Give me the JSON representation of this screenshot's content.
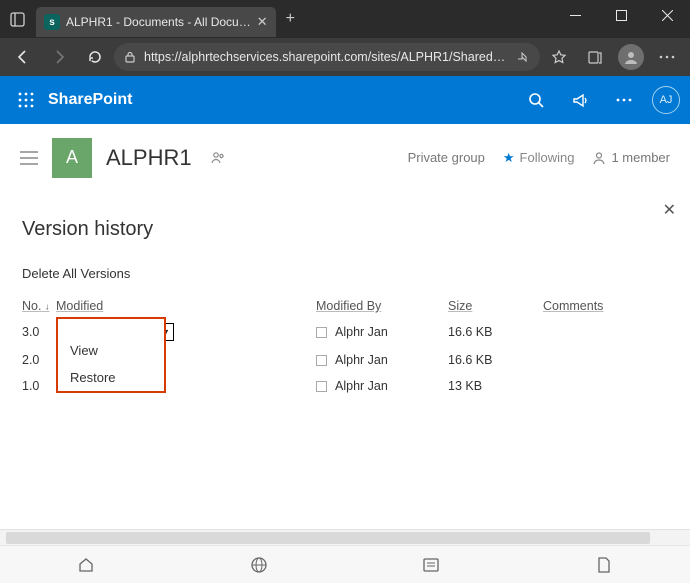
{
  "browser": {
    "tab_title": "ALPHR1 - Documents - All Docu…",
    "url": "https://alphrtechservices.sharepoint.com/sites/ALPHR1/Shared…"
  },
  "suite": {
    "brand": "SharePoint",
    "avatar": "AJ"
  },
  "site": {
    "letter": "A",
    "name": "ALPHR1",
    "group_type": "Private group",
    "following": "Following",
    "members": "1 member"
  },
  "panel": {
    "title": "Version history",
    "delete_all": "Delete All Versions",
    "columns": {
      "no": "No.",
      "modified": "Modified",
      "modified_by": "Modified By",
      "size": "Size",
      "comments": "Comments"
    },
    "rows": [
      {
        "no": "3.0",
        "by": "Alphr Jan",
        "size": "16.6 KB"
      },
      {
        "no": "2.0",
        "by": "Alphr Jan",
        "size": "16.6 KB"
      },
      {
        "no": "1.0",
        "by": "Alphr Jan",
        "size": "13 KB"
      }
    ],
    "menu": {
      "view": "View",
      "restore": "Restore"
    }
  }
}
